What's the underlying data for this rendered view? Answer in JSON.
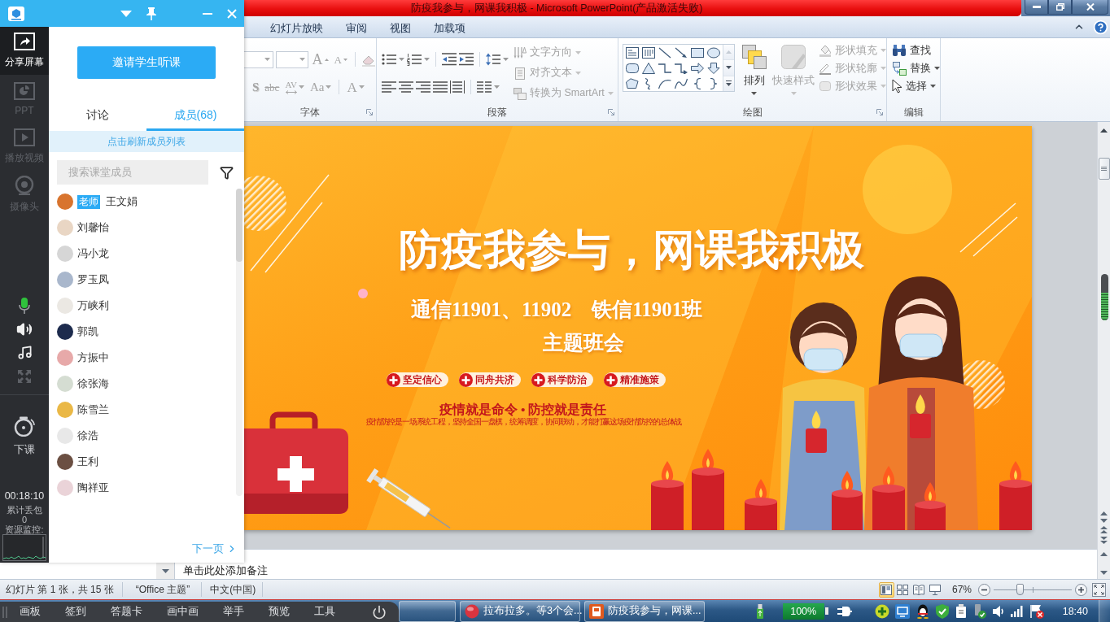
{
  "powerpoint": {
    "title": "防疫我参与，网课我积极 - Microsoft PowerPoint(产品激活失败)",
    "ribbon_tabs": [
      {
        "label": "幻灯片放映",
        "selected": false
      },
      {
        "label": "审阅",
        "selected": false
      },
      {
        "label": "视图",
        "selected": false
      },
      {
        "label": "加载项",
        "selected": false
      }
    ],
    "font_group": {
      "label": "字体",
      "disabled": true,
      "size_glyphs": [
        "A",
        "A"
      ],
      "format_glyphs": [
        "S",
        "abc",
        "AV",
        "Aa",
        "A"
      ]
    },
    "paragraph_group": {
      "label": "段落",
      "commands": [
        {
          "label": "文字方向",
          "disabled": true
        },
        {
          "label": "对齐文本",
          "disabled": true
        },
        {
          "label": "转换为 SmartArt",
          "disabled": true
        }
      ]
    },
    "drawing_group": {
      "label": "绘图",
      "large_commands": [
        {
          "label": "排列",
          "disabled": false
        },
        {
          "label": "快速样式",
          "disabled": true
        }
      ],
      "shape_commands": [
        {
          "label": "形状填充",
          "disabled": true
        },
        {
          "label": "形状轮廓",
          "disabled": true
        },
        {
          "label": "形状效果",
          "disabled": true
        }
      ]
    },
    "editing_group": {
      "label": "编辑",
      "commands": [
        {
          "label": "查找",
          "disabled": false
        },
        {
          "label": "替换",
          "disabled": false
        },
        {
          "label": "选择",
          "disabled": false
        }
      ]
    },
    "slide": {
      "title": "防疫我参与，网课我积极",
      "subtitle": "通信11901、11902　铁信11901班",
      "theme": "主题班会",
      "tags": [
        "坚定信心",
        "同舟共济",
        "科学防治",
        "精准施策"
      ],
      "slogan": "疫情就是命令 • 防控就是责任",
      "fine_print": "疫情防控是一场系统工程，坚持全国一盘棋，统筹调度，协同联动，才能打赢这场疫情防控的总体战"
    },
    "notes": {
      "prompt": "单击此处添加备注"
    },
    "status_bar": {
      "slide_info": "幻灯片 第 1 张，共 15 张",
      "theme": "“Office 主题”",
      "language": "中文(中国)",
      "views": [
        {
          "kind": "normal",
          "selected": true
        },
        {
          "kind": "sorter",
          "selected": false
        },
        {
          "kind": "reading",
          "selected": false
        },
        {
          "kind": "slideshow",
          "selected": false
        }
      ],
      "zoom": "67%",
      "zoom_slider": {
        "level": 0.33
      }
    }
  },
  "level_meter": {
    "level": 0.6
  },
  "classroom_panel": {
    "nav": [
      {
        "kind": "share",
        "label": "分享屏幕",
        "selected": true,
        "disabled": false
      },
      {
        "kind": "ppt",
        "label": "PPT",
        "selected": false,
        "disabled": true
      },
      {
        "kind": "video",
        "label": "播放视频",
        "selected": false,
        "disabled": true
      },
      {
        "kind": "camera",
        "label": "摄像头",
        "selected": false,
        "disabled": true
      }
    ],
    "audio_controls": [
      {
        "kind": "microphone",
        "disabled": false
      },
      {
        "kind": "speaker",
        "disabled": false
      },
      {
        "kind": "music",
        "disabled": false
      },
      {
        "kind": "fullscreen",
        "disabled": true
      }
    ],
    "end_class": "下课",
    "timer": "00:18:10",
    "packet_loss_label": "累计丢包",
    "packet_loss": "0",
    "monitor_label": "资源监控:",
    "invite_button": "邀请学生听课",
    "tabs": [
      {
        "label": "讨论",
        "selected": false
      },
      {
        "label": "成员(68)",
        "selected": true
      }
    ],
    "refresh_banner": "点击刷新成员列表",
    "search": {
      "placeholder": "搜索课堂成员"
    },
    "members": [
      {
        "name": "王文娟",
        "badge": "老师",
        "color": "#d8742e"
      },
      {
        "name": "刘馨怡",
        "color": "#e9d6c4"
      },
      {
        "name": "冯小龙",
        "color": "#d6d6d6"
      },
      {
        "name": "罗玉凤",
        "color": "#a9b7cc"
      },
      {
        "name": "万峡利",
        "color": "#ebe8e3"
      },
      {
        "name": "郭凯",
        "color": "#1d2b4d"
      },
      {
        "name": "方振中",
        "color": "#e7a9a9"
      },
      {
        "name": "徐张海",
        "color": "#d5ddd2"
      },
      {
        "name": "陈雪兰",
        "color": "#eab846"
      },
      {
        "name": "徐浩",
        "color": "#e8e8e8"
      },
      {
        "name": "王利",
        "color": "#6b4f42"
      },
      {
        "name": "陶祥亚",
        "color": "#ead3d8"
      }
    ],
    "next_page": "下一页"
  },
  "floating_toolbar": {
    "items": [
      "画板",
      "签到",
      "答题卡",
      "画中画",
      "举手",
      "预览",
      "工具"
    ]
  },
  "taskbar": {
    "windows": [
      {
        "kind": "chat",
        "label": "拉布拉多。等3个会..."
      },
      {
        "kind": "presentation",
        "label": "防疫我参与，网课..."
      }
    ],
    "battery": "100%",
    "clock": "18:40"
  }
}
